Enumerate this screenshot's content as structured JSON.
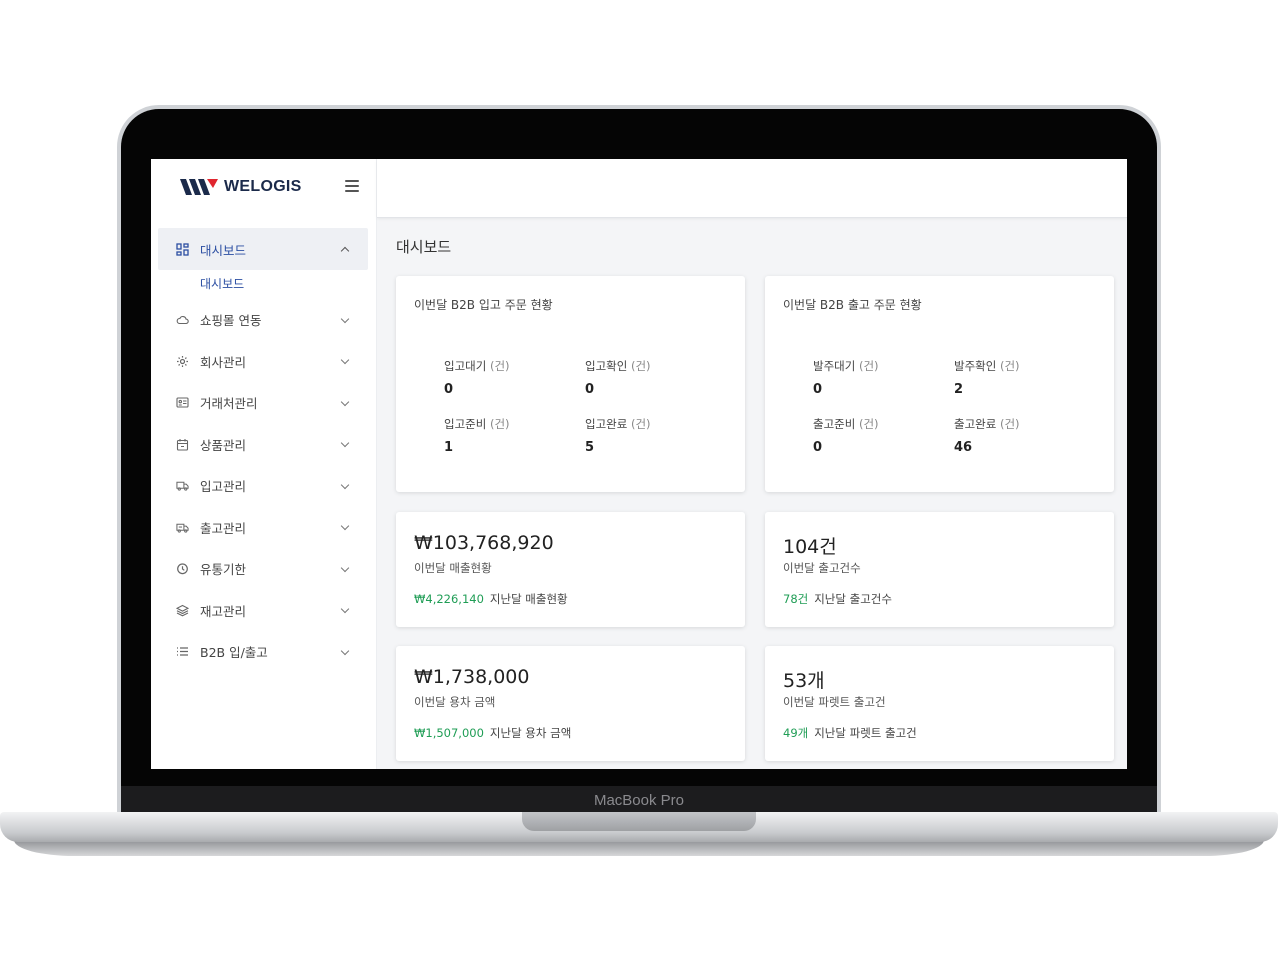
{
  "device": {
    "label": "MacBook Pro"
  },
  "brand": {
    "name": "WELOGIS"
  },
  "sidebar": {
    "items": [
      {
        "label": "대시보드",
        "icon": "dashboard-icon",
        "active": true,
        "sub": [
          "대시보드"
        ]
      },
      {
        "label": "쇼핑몰 연동",
        "icon": "cloud-icon"
      },
      {
        "label": "회사관리",
        "icon": "gear-icon"
      },
      {
        "label": "거래처관리",
        "icon": "contact-card-icon"
      },
      {
        "label": "상품관리",
        "icon": "calendar-box-icon"
      },
      {
        "label": "입고관리",
        "icon": "truck-in-icon"
      },
      {
        "label": "출고관리",
        "icon": "truck-out-icon"
      },
      {
        "label": "유통기한",
        "icon": "timer-icon"
      },
      {
        "label": "재고관리",
        "icon": "layers-icon"
      },
      {
        "label": "B2B 입/출고",
        "icon": "list-icon"
      }
    ]
  },
  "main": {
    "title": "대시보드",
    "inbound": {
      "title": "이번달 B2B 입고 주문 현황",
      "stats": [
        {
          "label": "입고대기",
          "unit": "(건)",
          "value": "0"
        },
        {
          "label": "입고확인",
          "unit": "(건)",
          "value": "0"
        },
        {
          "label": "입고준비",
          "unit": "(건)",
          "value": "1"
        },
        {
          "label": "입고완료",
          "unit": "(건)",
          "value": "5"
        }
      ]
    },
    "outbound": {
      "title": "이번달 B2B 출고 주문 현황",
      "stats": [
        {
          "label": "발주대기",
          "unit": "(건)",
          "value": "0"
        },
        {
          "label": "발주확인",
          "unit": "(건)",
          "value": "2"
        },
        {
          "label": "출고준비",
          "unit": "(건)",
          "value": "0"
        },
        {
          "label": "출고완료",
          "unit": "(건)",
          "value": "46"
        }
      ]
    },
    "metrics": [
      {
        "value": "₩103,768,920",
        "label": "이번달 매출현황",
        "prev_value": "₩4,226,140",
        "prev_label": "지난달 매출현황"
      },
      {
        "value": "104건",
        "label": "이번달 출고건수",
        "prev_value": "78건",
        "prev_label": "지난달 출고건수"
      },
      {
        "value": "₩1,738,000",
        "label": "이번달 용차 금액",
        "prev_value": "₩1,507,000",
        "prev_label": "지난달 용차 금액"
      },
      {
        "value": "53개",
        "label": "이번달 파렛트 출고건",
        "prev_value": "49개",
        "prev_label": "지난달 파렛트 출고건"
      }
    ]
  },
  "colors": {
    "accent": "#2b4ea2",
    "positive": "#1f9d55",
    "brand_red": "#e0262f",
    "brand_navy": "#1b2a4a"
  }
}
